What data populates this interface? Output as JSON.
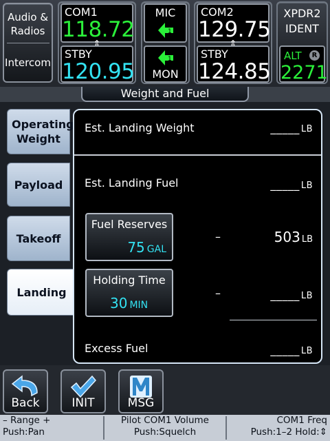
{
  "radio": {
    "audio_label_1": "Audio &",
    "audio_label_2": "Radios",
    "intercom_label": "Intercom",
    "com1": {
      "title": "COM1",
      "active": "118.72",
      "stby_title": "STBY",
      "standby": "120.95",
      "swap": "⇕"
    },
    "mic": {
      "title": "MIC",
      "mon_label": "MON"
    },
    "com2": {
      "title": "COM2",
      "active": "129.75",
      "stby_title": "STBY",
      "standby": "124.85",
      "swap": "⇕"
    },
    "xpdr": {
      "title": "XPDR2",
      "ident_label": "IDENT",
      "mode": "ALT",
      "reply": "R",
      "code": "2271"
    }
  },
  "page": {
    "title": "Weight and Fuel"
  },
  "tabs": [
    {
      "label": "Operating Weight",
      "active": false
    },
    {
      "label": "Payload",
      "active": false
    },
    {
      "label": "Takeoff",
      "active": false
    },
    {
      "label": "Landing",
      "active": true
    }
  ],
  "landing": {
    "est_landing_weight": {
      "label": "Est. Landing Weight",
      "value": "_____",
      "unit": "LB"
    },
    "est_landing_fuel": {
      "label": "Est. Landing Fuel",
      "value": "_____",
      "unit": "LB"
    },
    "fuel_reserves": {
      "label": "Fuel Reserves",
      "value": "75",
      "unit": "GAL",
      "operator": "–",
      "result": "503",
      "result_unit": "LB"
    },
    "holding_time": {
      "label": "Holding Time",
      "value": "30",
      "unit": "MIN",
      "operator": "–",
      "result": "_____",
      "result_unit": "LB"
    },
    "excess_fuel": {
      "label": "Excess Fuel",
      "value": "_____",
      "unit": "LB"
    }
  },
  "softkeys": {
    "back": {
      "label": "Back",
      "icon": "back-arrow-icon"
    },
    "init": {
      "label": "INIT",
      "icon": "checkmark-icon"
    },
    "msg": {
      "label": "MSG",
      "icon": "m-letter-icon"
    }
  },
  "status": {
    "left_1": "– Range +",
    "left_2": "Push:Pan",
    "mid_1": "Pilot COM1 Volume",
    "mid_2": "Push:Squelch",
    "right_1": "COM1 Freq",
    "right_2": "Push:1–2 Hold:⇕"
  },
  "colors": {
    "active_freq": "#2bf03a",
    "standby_freq": "#33e2f2",
    "panel_border": "#d6e6f6"
  }
}
